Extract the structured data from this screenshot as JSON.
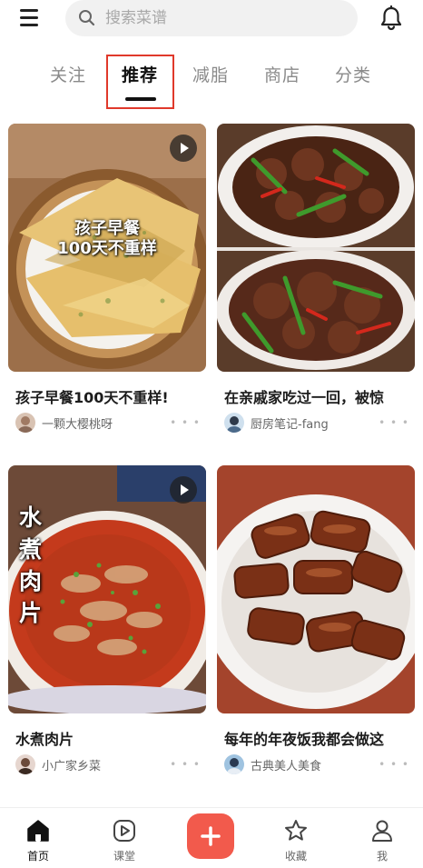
{
  "search": {
    "placeholder": "搜索菜谱"
  },
  "tabs": [
    {
      "label": "关注"
    },
    {
      "label": "推荐"
    },
    {
      "label": "减脂"
    },
    {
      "label": "商店"
    },
    {
      "label": "分类"
    }
  ],
  "active_tab": "推荐",
  "feed": [
    {
      "title": "孩子早餐100天不重样!",
      "author": "一颗大樱桃呀",
      "image_caption_line1": "孩子早餐",
      "image_caption_line2": "100天不重样",
      "has_video": true
    },
    {
      "title": "在亲戚家吃过一回，被惊",
      "author": "厨房笔记-fang",
      "has_video": false
    },
    {
      "title": "水煮肉片",
      "author": "小广家乡菜",
      "image_caption": "水煮肉片",
      "has_video": true
    },
    {
      "title": "每年的年夜饭我都会做这",
      "author": "古典美人美食",
      "has_video": false
    }
  ],
  "more_glyph": "• • •",
  "bottom_nav": [
    {
      "label": "首页",
      "icon": "home-icon",
      "active": true
    },
    {
      "label": "课堂",
      "icon": "play-square-icon",
      "active": false
    },
    {
      "label": "",
      "icon": "plus-icon",
      "active": false
    },
    {
      "label": "收藏",
      "icon": "star-icon",
      "active": false
    },
    {
      "label": "我",
      "icon": "person-icon",
      "active": false
    }
  ],
  "colors": {
    "accent": "#f25a4c",
    "highlight_box": "#e0392b",
    "search_bg": "#f1f1f1"
  }
}
